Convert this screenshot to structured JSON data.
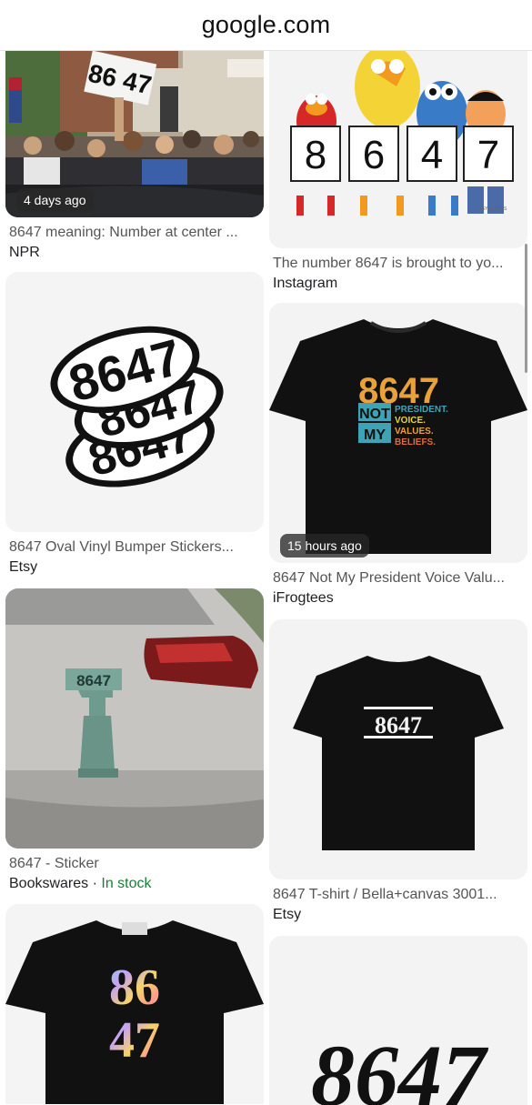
{
  "browser": {
    "domain": "google.com"
  },
  "results_left": [
    {
      "caption": "8647 meaning: Number at center ...",
      "source": "NPR",
      "badge": "4 days ago",
      "sign_text": "86 47"
    },
    {
      "caption": "8647 Oval Vinyl Bumper Stickers...",
      "source": "Etsy",
      "sticker_text": "8647"
    },
    {
      "caption": "8647 - Sticker",
      "source": "Bookswares",
      "separator": " · ",
      "stock": "In stock",
      "sign_text": "8647"
    },
    {
      "caption": "",
      "source": "",
      "print_top": "86",
      "print_bottom": "47"
    }
  ],
  "results_right": [
    {
      "caption": "The number 8647 is brought to yo...",
      "source": "Instagram",
      "cards": [
        "8",
        "6",
        "4",
        "7"
      ],
      "artist": "CSYQUEERS"
    },
    {
      "caption": "8647 Not My President Voice Valu...",
      "source": "iFrogtees",
      "badge": "15 hours ago",
      "shirt": {
        "number": "8647",
        "not": "NOT",
        "my": "MY",
        "lines": [
          "PRESIDENT.",
          "VOICE.",
          "VALUES.",
          "BELIEFS."
        ]
      }
    },
    {
      "caption": "8647 T-shirt / Bella+canvas 3001...",
      "source": "Etsy",
      "shirt_text": "8647"
    },
    {
      "caption": "",
      "source": "",
      "script_text": "8647"
    }
  ],
  "colors": {
    "in_stock": "#188038",
    "badge_bg": "#3a3a3a"
  }
}
